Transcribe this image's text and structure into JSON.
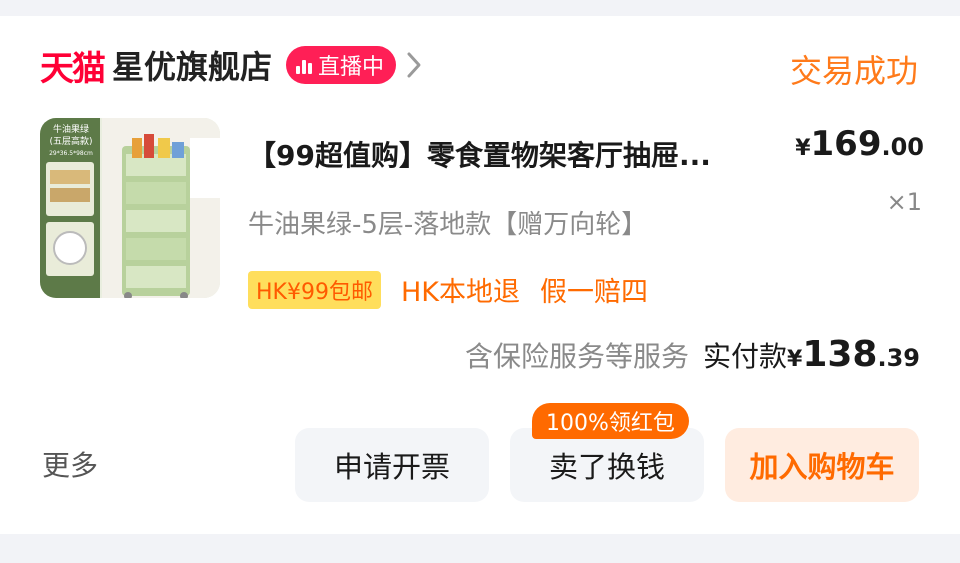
{
  "shop": {
    "platform_logo": "天猫",
    "name": "星优旗舰店",
    "live_label": "直播中",
    "chevron_icon": "chevron-right-icon",
    "order_status": "交易成功"
  },
  "product": {
    "image_text": {
      "color_name": "牛油果绿",
      "layers": "(五层高款)",
      "size": "29*36.5*98cm"
    },
    "title": "【99超值购】零食置物架客厅抽屉...",
    "price_symbol": "¥",
    "price_int": "169",
    "price_dec": ".00",
    "quantity": "×1",
    "sku": "牛油果绿-5层-落地款【赠万向轮】",
    "tags": [
      "HK¥99包邮",
      "HK本地退",
      "假一赔四"
    ]
  },
  "payment": {
    "services": "含保险服务等服务",
    "paid_label": "实付款",
    "paid_symbol": "¥",
    "paid_int": "138",
    "paid_dec": ".39"
  },
  "actions": {
    "more": "更多",
    "invoice": "申请开票",
    "sell": "卖了换钱",
    "sell_promo": "100%领红包",
    "add_cart": "加入购物车"
  },
  "colors": {
    "tmall_red": "#ff0036",
    "accent_orange": "#ff6a00",
    "live_pink": "#ff1f56"
  }
}
